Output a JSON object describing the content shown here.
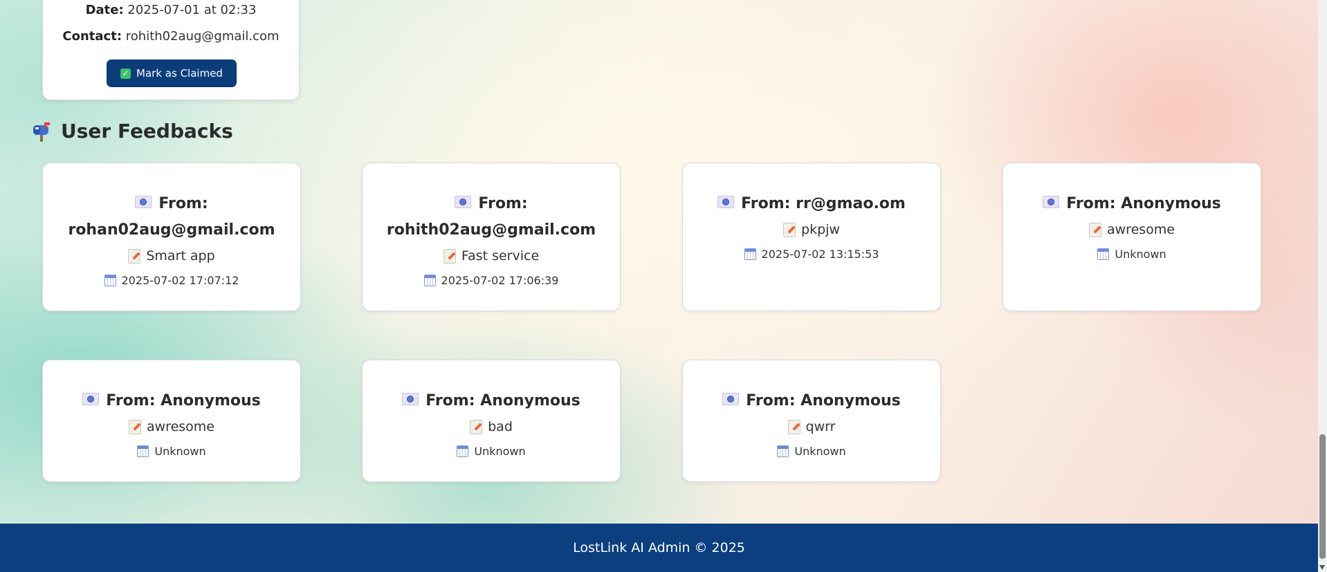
{
  "claim_card": {
    "date_label": "Date:",
    "date_value": "2025-07-01 at 02:33",
    "contact_label": "Contact:",
    "contact_value": "rohith02aug@gmail.com",
    "button_label": "Mark as Claimed",
    "button_icon": "check-box-icon"
  },
  "feedback_section": {
    "title": "User Feedbacks",
    "icon": "mailbox-icon",
    "items": [
      {
        "from": "From: rohan02aug@gmail.com",
        "message": "Smart app",
        "date": "2025-07-02 17:07:12"
      },
      {
        "from": "From: rohith02aug@gmail.com",
        "message": "Fast service",
        "date": "2025-07-02 17:06:39"
      },
      {
        "from": "From: rr@gmao.om",
        "message": "pkpjw",
        "date": "2025-07-02 13:15:53"
      },
      {
        "from": "From: Anonymous",
        "message": "awresome",
        "date": "Unknown"
      },
      {
        "from": "From: Anonymous",
        "message": "awresome",
        "date": "Unknown"
      },
      {
        "from": "From: Anonymous",
        "message": "bad",
        "date": "Unknown"
      },
      {
        "from": "From: Anonymous",
        "message": "qwrr",
        "date": "Unknown"
      }
    ]
  },
  "footer": {
    "text": "LostLink AI Admin © 2025",
    "background": "#0b3f80"
  },
  "colors": {
    "accent": "#0b3d7a",
    "card_bg": "#ffffff"
  }
}
